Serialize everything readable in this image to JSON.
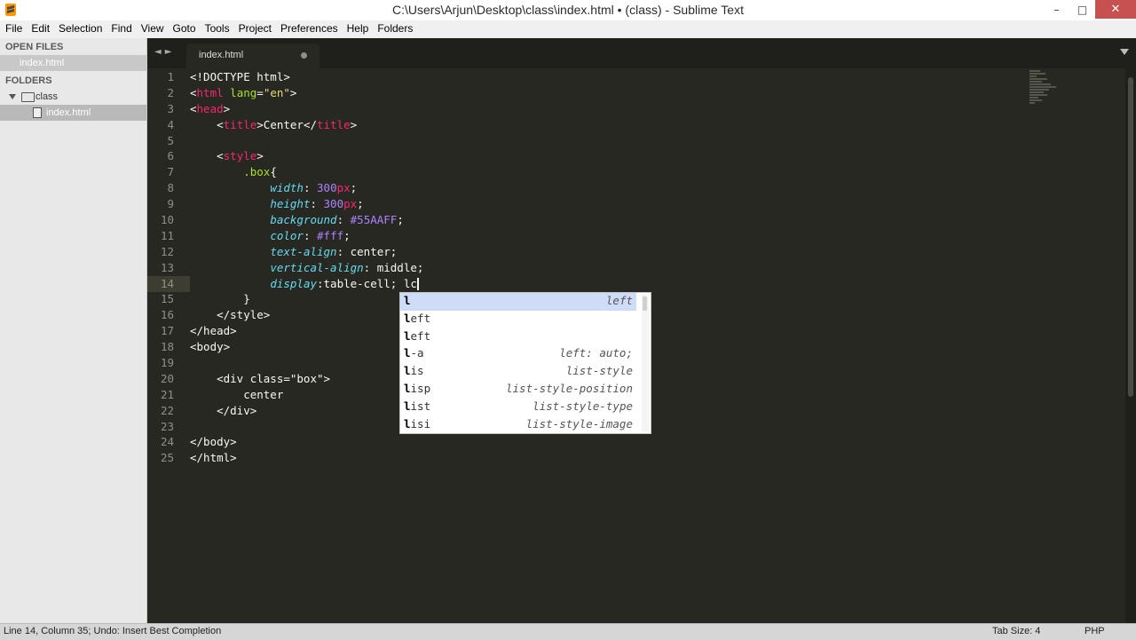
{
  "window": {
    "title": "C:\\Users\\Arjun\\Desktop\\class\\index.html • (class) - Sublime Text",
    "minimize_label": "–",
    "maximize_label": "□",
    "close_label": "✕"
  },
  "menu": [
    "File",
    "Edit",
    "Selection",
    "Find",
    "View",
    "Goto",
    "Tools",
    "Project",
    "Preferences",
    "Help",
    "Folders"
  ],
  "sidebar": {
    "open_files_header": "OPEN FILES",
    "open_files": [
      "index.html"
    ],
    "folders_header": "FOLDERS",
    "folder_name": "class",
    "folder_files": [
      "index.html"
    ]
  },
  "tabs": {
    "nav": "◄►",
    "active": "index.html"
  },
  "editor": {
    "line_numbers": [
      "1",
      "2",
      "3",
      "4",
      "5",
      "6",
      "7",
      "8",
      "9",
      "10",
      "11",
      "12",
      "13",
      "14",
      "15",
      "16",
      "17",
      "18",
      "19",
      "20",
      "21",
      "22",
      "23",
      "24",
      "25"
    ],
    "current_line": 14,
    "tokens": [
      [
        [
          "t",
          "<!DOCTYPE html>"
        ]
      ],
      [
        [
          "t",
          "<"
        ],
        [
          "tg",
          "html"
        ],
        [
          "t",
          " "
        ],
        [
          "at",
          "lang"
        ],
        [
          "t",
          "="
        ],
        [
          "st",
          "\"en\""
        ],
        [
          "t",
          ">"
        ]
      ],
      [
        [
          "t",
          "<"
        ],
        [
          "tg",
          "head"
        ],
        [
          "t",
          ">"
        ]
      ],
      [
        [
          "t",
          "    <"
        ],
        [
          "tg",
          "title"
        ],
        [
          "t",
          ">Center</"
        ],
        [
          "tg",
          "title"
        ],
        [
          "t",
          ">"
        ]
      ],
      [
        [
          "t",
          ""
        ]
      ],
      [
        [
          "t",
          "    <"
        ],
        [
          "tg",
          "style"
        ],
        [
          "t",
          ">"
        ]
      ],
      [
        [
          "t",
          "        "
        ],
        [
          "cls",
          ".box"
        ],
        [
          "t",
          "{"
        ]
      ],
      [
        [
          "t",
          "            "
        ],
        [
          "pr",
          "width"
        ],
        [
          "t",
          ": "
        ],
        [
          "nm",
          "300"
        ],
        [
          "un",
          "px"
        ],
        [
          "t",
          ";"
        ]
      ],
      [
        [
          "t",
          "            "
        ],
        [
          "pr",
          "height"
        ],
        [
          "t",
          ": "
        ],
        [
          "nm",
          "300"
        ],
        [
          "un",
          "px"
        ],
        [
          "t",
          ";"
        ]
      ],
      [
        [
          "t",
          "            "
        ],
        [
          "pr",
          "background"
        ],
        [
          "t",
          ": "
        ],
        [
          "nm",
          "#55AAFF"
        ],
        [
          "t",
          ";"
        ]
      ],
      [
        [
          "t",
          "            "
        ],
        [
          "pr",
          "color"
        ],
        [
          "t",
          ": "
        ],
        [
          "nm",
          "#fff"
        ],
        [
          "t",
          ";"
        ]
      ],
      [
        [
          "t",
          "            "
        ],
        [
          "pr",
          "text-align"
        ],
        [
          "t",
          ": center;"
        ]
      ],
      [
        [
          "t",
          "            "
        ],
        [
          "pr",
          "vertical-align"
        ],
        [
          "t",
          ": middle;"
        ]
      ],
      [
        [
          "t",
          "            "
        ],
        [
          "pr",
          "display"
        ],
        [
          "t",
          ":table-cell; lc"
        ]
      ],
      [
        [
          "t",
          "        }"
        ]
      ],
      [
        [
          "t",
          "    </style>"
        ]
      ],
      [
        [
          "t",
          "</head>"
        ]
      ],
      [
        [
          "t",
          "<body>"
        ]
      ],
      [
        [
          "t",
          ""
        ]
      ],
      [
        [
          "t",
          "    <div class=\"box\">"
        ]
      ],
      [
        [
          "t",
          "        center"
        ]
      ],
      [
        [
          "t",
          "    </div>"
        ]
      ],
      [
        [
          "t",
          ""
        ]
      ],
      [
        [
          "t",
          "</body>"
        ]
      ],
      [
        [
          "t",
          "</html>"
        ]
      ]
    ]
  },
  "autocomplete": {
    "items": [
      {
        "trigger": "l",
        "rest": "",
        "hint": "left",
        "selected": true
      },
      {
        "trigger": "l",
        "rest": "eft",
        "hint": "",
        "selected": false
      },
      {
        "trigger": "l",
        "rest": "eft",
        "hint": "",
        "selected": false
      },
      {
        "trigger": "l",
        "rest": "-a",
        "hint": "left: auto;",
        "selected": false
      },
      {
        "trigger": "l",
        "rest": "is",
        "hint": "list-style",
        "selected": false
      },
      {
        "trigger": "l",
        "rest": "isp",
        "hint": "list-style-position",
        "selected": false
      },
      {
        "trigger": "l",
        "rest": "ist",
        "hint": "list-style-type",
        "selected": false
      },
      {
        "trigger": "l",
        "rest": "isi",
        "hint": "list-style-image",
        "selected": false
      }
    ]
  },
  "status": {
    "left": "Line 14, Column 35; Undo: Insert Best Completion",
    "tab_size": "Tab Size: 4",
    "syntax": "PHP"
  },
  "colors": {
    "editor_bg": "#272822",
    "tag": "#f92672",
    "attr": "#a6e22e",
    "string": "#e6db74",
    "property": "#66d9ef",
    "number": "#ae81ff"
  }
}
